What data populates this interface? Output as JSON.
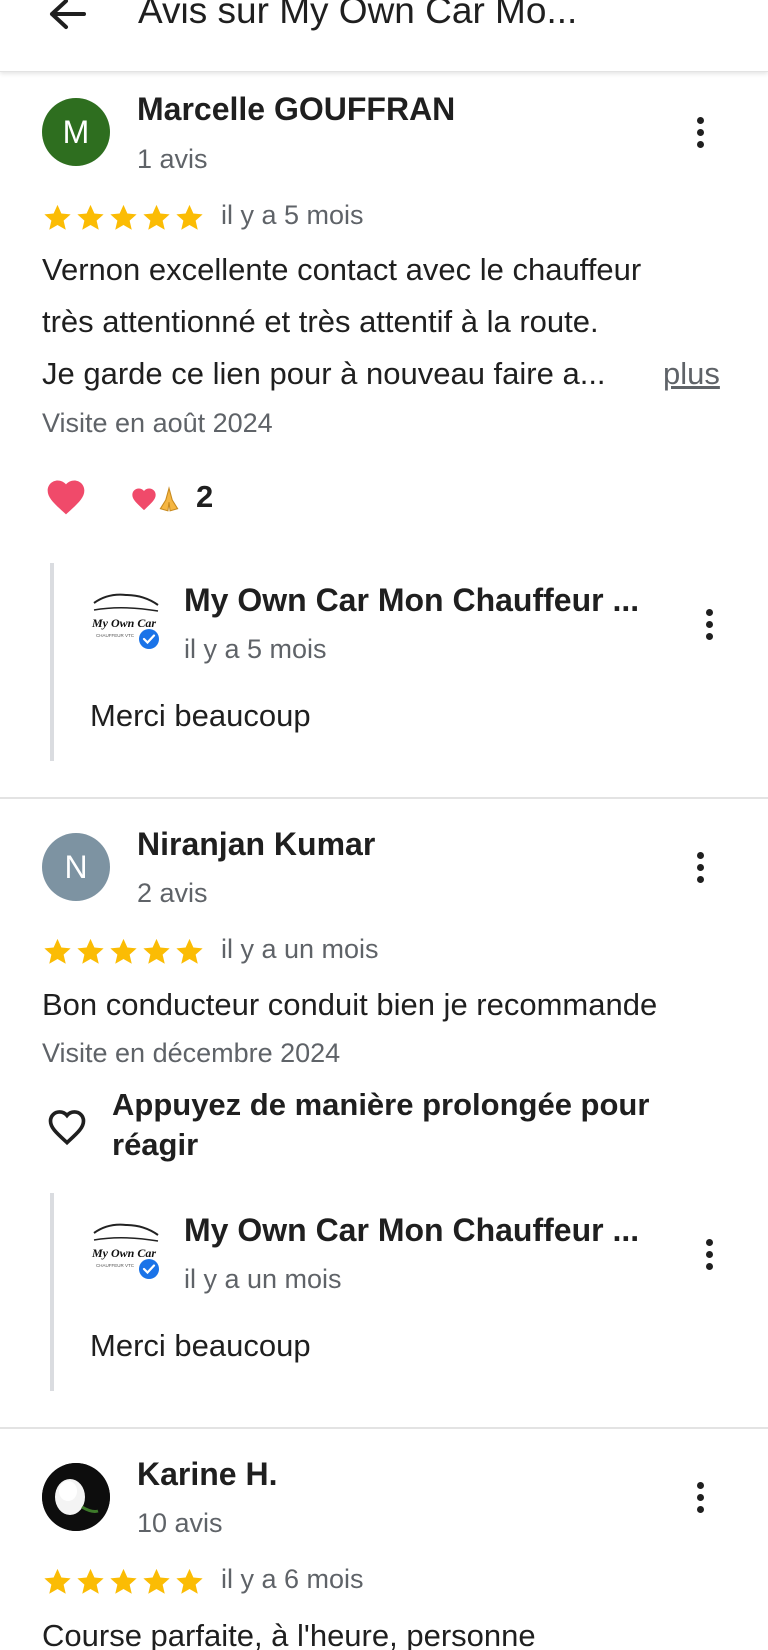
{
  "header": {
    "title": "Avis sur My Own Car Mo..."
  },
  "reviews": [
    {
      "author": "Marcelle GOUFFRAN",
      "initial": "M",
      "avatar_color": "#2e6e1f",
      "review_count": "1 avis",
      "rating": 5,
      "date": "il y a 5 mois",
      "text_lines": [
        "Vernon excellente contact avec le chauffeur",
        "très attentionné et très attentif à la route.",
        "Je garde ce lien pour à nouveau faire a..."
      ],
      "more_label": "plus",
      "visit": "Visite en août 2024",
      "reaction_count": "2",
      "owner_reply": {
        "name": "My Own Car Mon Chauffeur ...",
        "date": "il y a 5 mois",
        "text": "Merci beaucoup"
      }
    },
    {
      "author": "Niranjan Kumar",
      "initial": "N",
      "avatar_color": "#7d93a2",
      "review_count": "2 avis",
      "rating": 5,
      "date": "il y a un mois",
      "text_lines": [
        "Bon conducteur conduit bien je recommande"
      ],
      "visit": "Visite en décembre 2024",
      "react_hint": [
        "Appuyez de manière prolongée pour",
        "réagir"
      ],
      "owner_reply": {
        "name": "My Own Car Mon Chauffeur ...",
        "date": "il y a un mois",
        "text": "Merci beaucoup"
      }
    },
    {
      "author": "Karine H.",
      "review_count": "10 avis",
      "rating": 5,
      "date": "il y a 6 mois",
      "text_lines": [
        "Course parfaite, à l'heure, personne"
      ]
    }
  ],
  "owner_logo_text": {
    "brand": "My Own Car",
    "sub": "CHAUFFEUR VTC"
  },
  "colors": {
    "star": "#fbbc04",
    "verified": "#1a73e8",
    "heart": "#f04a6a"
  },
  "icons": [
    "back-arrow-icon",
    "star-icon",
    "more-vert-icon",
    "heart-icon",
    "verified-icon",
    "heart-outline-icon",
    "pray-icon"
  ]
}
